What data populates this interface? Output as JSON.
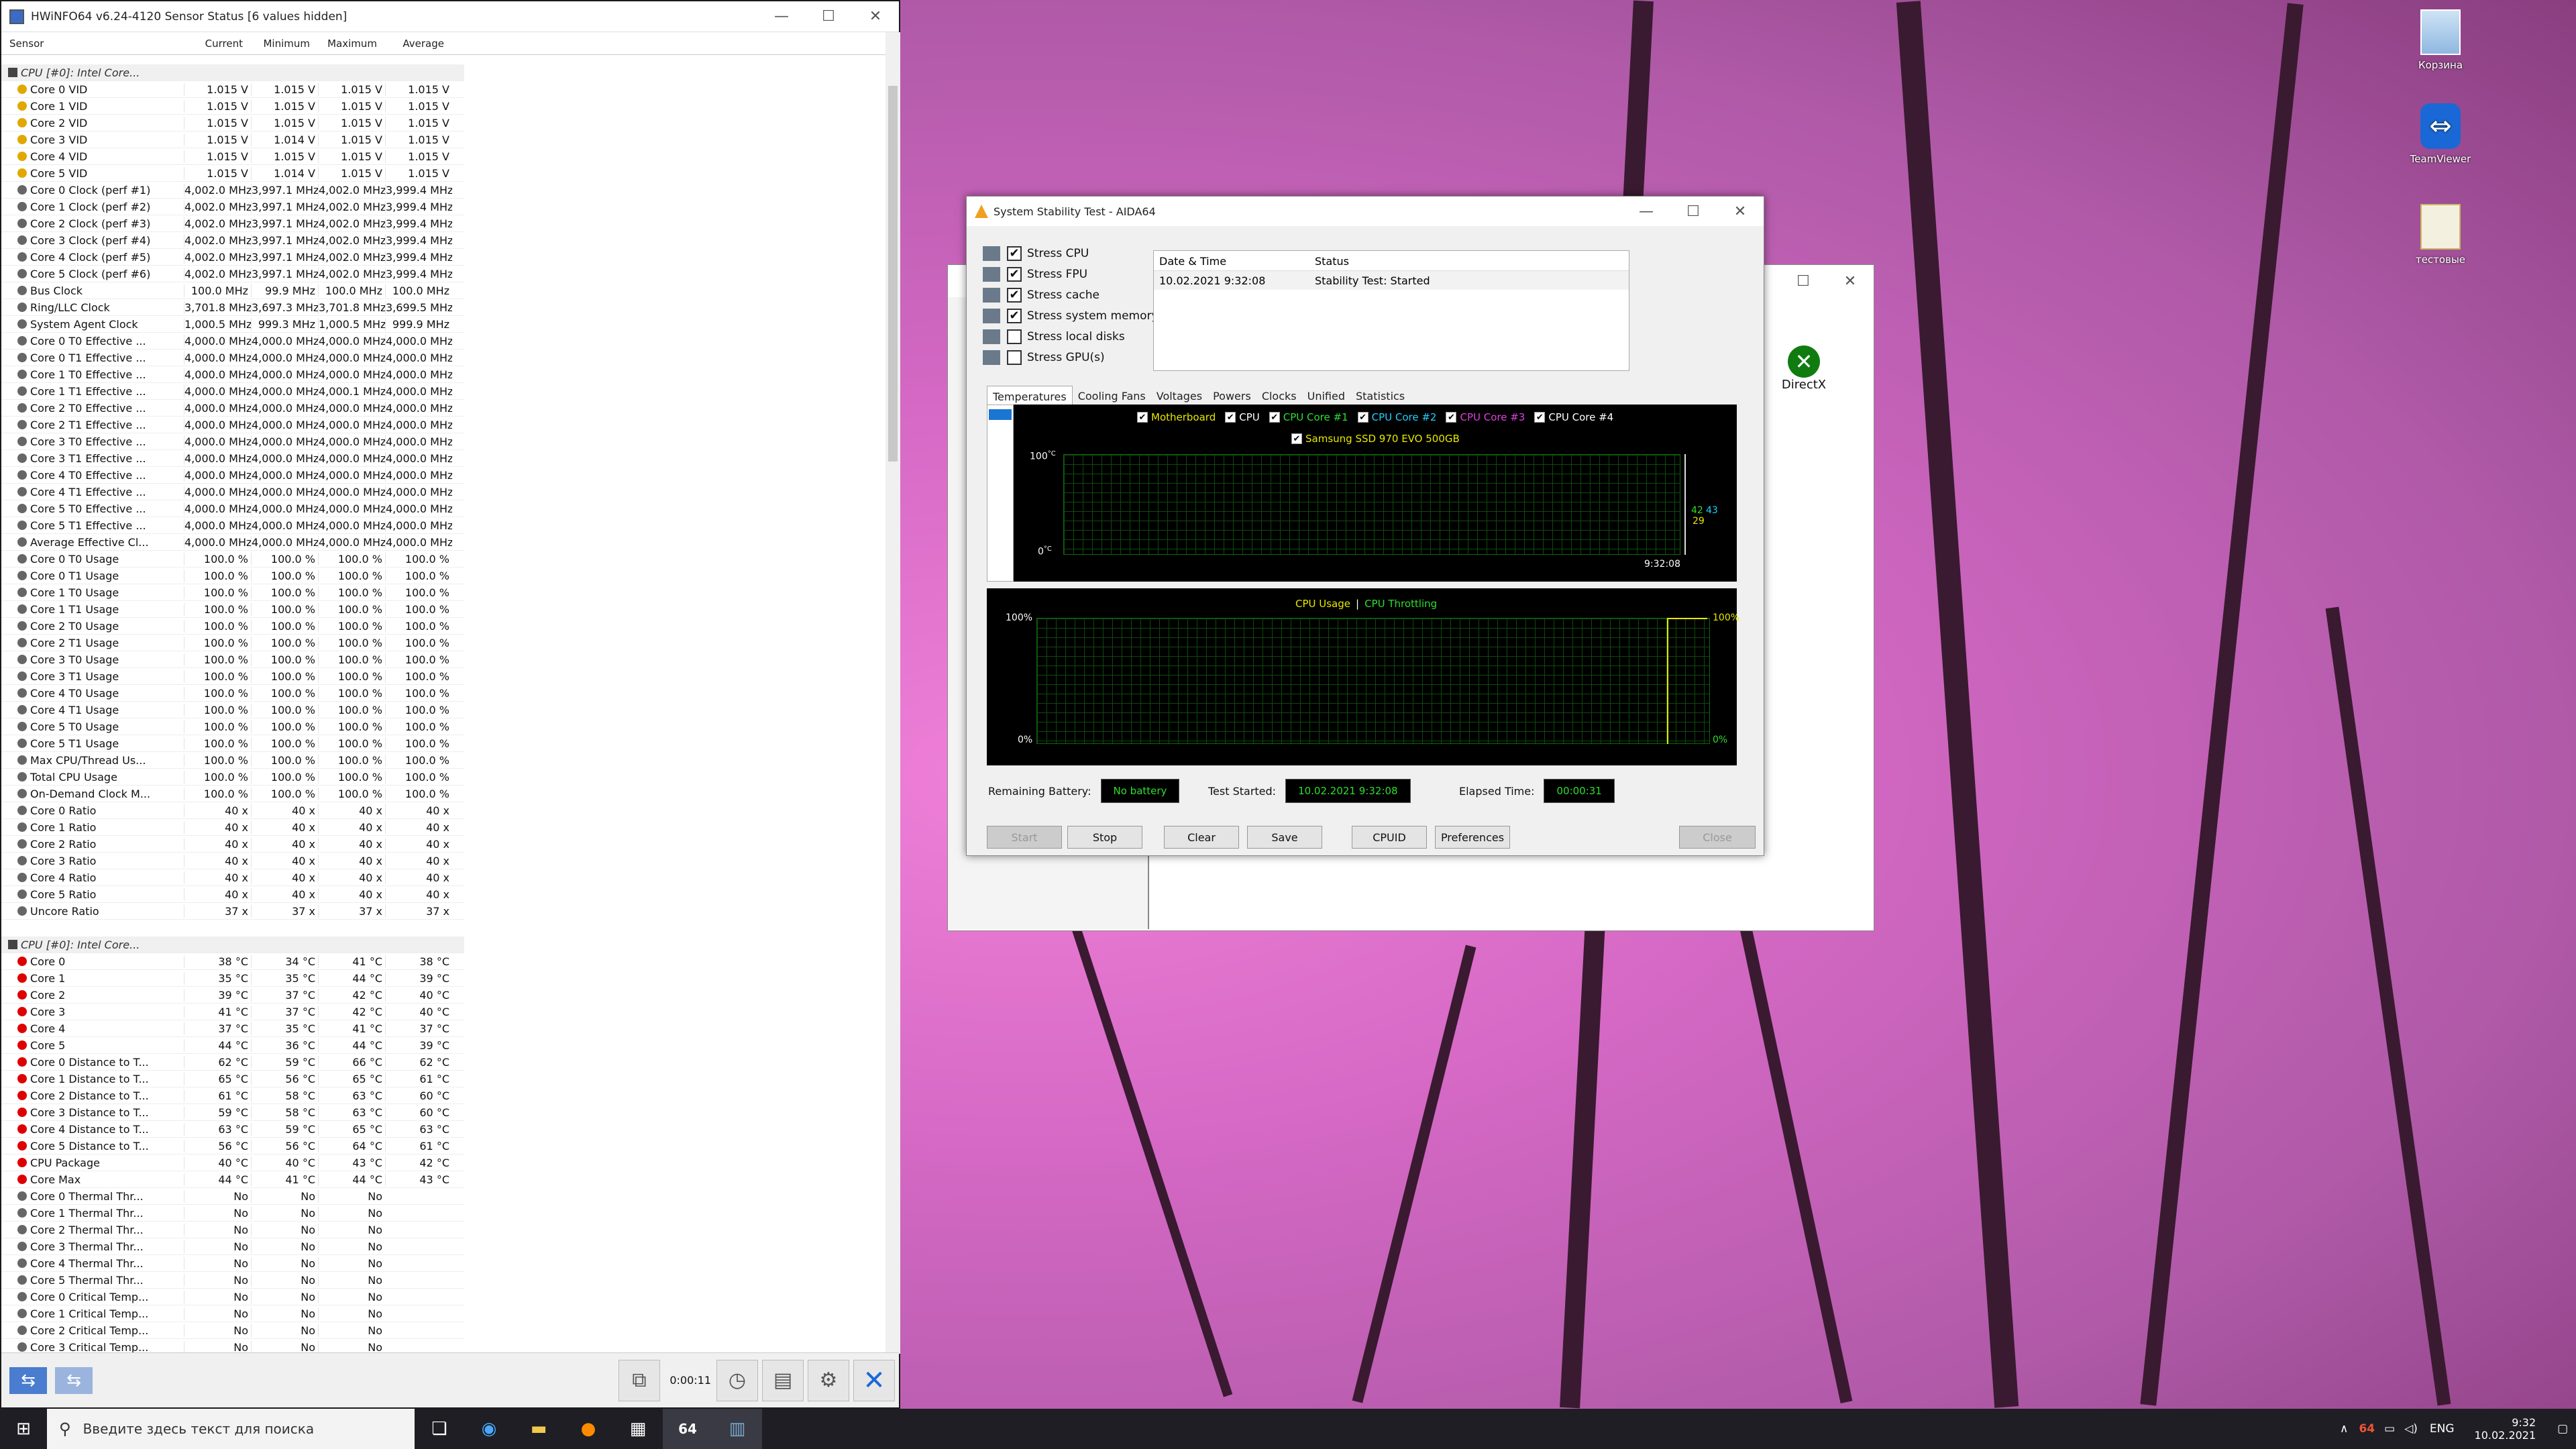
{
  "hwinfo": {
    "title": "HWiNFO64 v6.24-4120 Sensor Status [6 values hidden]",
    "columns": [
      "Sensor",
      "Current",
      "Minimum",
      "Maximum",
      "Average"
    ],
    "rows": [
      {
        "n": "CPU [#0]: Intel Core...",
        "v": [
          "",
          "",
          "",
          ""
        ],
        "g": true,
        "i": "#444"
      },
      {
        "n": "Core 0 VID",
        "v": [
          "1.015 V",
          "1.015 V",
          "1.015 V",
          "1.015 V"
        ],
        "i": "#e0a800"
      },
      {
        "n": "Core 1 VID",
        "v": [
          "1.015 V",
          "1.015 V",
          "1.015 V",
          "1.015 V"
        ],
        "i": "#e0a800"
      },
      {
        "n": "Core 2 VID",
        "v": [
          "1.015 V",
          "1.015 V",
          "1.015 V",
          "1.015 V"
        ],
        "i": "#e0a800"
      },
      {
        "n": "Core 3 VID",
        "v": [
          "1.015 V",
          "1.014 V",
          "1.015 V",
          "1.015 V"
        ],
        "i": "#e0a800"
      },
      {
        "n": "Core 4 VID",
        "v": [
          "1.015 V",
          "1.015 V",
          "1.015 V",
          "1.015 V"
        ],
        "i": "#e0a800"
      },
      {
        "n": "Core 5 VID",
        "v": [
          "1.015 V",
          "1.014 V",
          "1.015 V",
          "1.015 V"
        ],
        "i": "#e0a800"
      },
      {
        "n": "Core 0 Clock (perf #1)",
        "v": [
          "4,002.0 MHz",
          "3,997.1 MHz",
          "4,002.0 MHz",
          "3,999.4 MHz"
        ],
        "i": "#666"
      },
      {
        "n": "Core 1 Clock (perf #2)",
        "v": [
          "4,002.0 MHz",
          "3,997.1 MHz",
          "4,002.0 MHz",
          "3,999.4 MHz"
        ],
        "i": "#666"
      },
      {
        "n": "Core 2 Clock (perf #3)",
        "v": [
          "4,002.0 MHz",
          "3,997.1 MHz",
          "4,002.0 MHz",
          "3,999.4 MHz"
        ],
        "i": "#666"
      },
      {
        "n": "Core 3 Clock (perf #4)",
        "v": [
          "4,002.0 MHz",
          "3,997.1 MHz",
          "4,002.0 MHz",
          "3,999.4 MHz"
        ],
        "i": "#666"
      },
      {
        "n": "Core 4 Clock (perf #5)",
        "v": [
          "4,002.0 MHz",
          "3,997.1 MHz",
          "4,002.0 MHz",
          "3,999.4 MHz"
        ],
        "i": "#666"
      },
      {
        "n": "Core 5 Clock (perf #6)",
        "v": [
          "4,002.0 MHz",
          "3,997.1 MHz",
          "4,002.0 MHz",
          "3,999.4 MHz"
        ],
        "i": "#666"
      },
      {
        "n": "Bus Clock",
        "v": [
          "100.0 MHz",
          "99.9 MHz",
          "100.0 MHz",
          "100.0 MHz"
        ],
        "i": "#666"
      },
      {
        "n": "Ring/LLC Clock",
        "v": [
          "3,701.8 MHz",
          "3,697.3 MHz",
          "3,701.8 MHz",
          "3,699.5 MHz"
        ],
        "i": "#666"
      },
      {
        "n": "System Agent Clock",
        "v": [
          "1,000.5 MHz",
          "999.3 MHz",
          "1,000.5 MHz",
          "999.9 MHz"
        ],
        "i": "#666"
      },
      {
        "n": "Core 0 T0 Effective ...",
        "v": [
          "4,000.0 MHz",
          "4,000.0 MHz",
          "4,000.0 MHz",
          "4,000.0 MHz"
        ],
        "i": "#666"
      },
      {
        "n": "Core 0 T1 Effective ...",
        "v": [
          "4,000.0 MHz",
          "4,000.0 MHz",
          "4,000.0 MHz",
          "4,000.0 MHz"
        ],
        "i": "#666"
      },
      {
        "n": "Core 1 T0 Effective ...",
        "v": [
          "4,000.0 MHz",
          "4,000.0 MHz",
          "4,000.0 MHz",
          "4,000.0 MHz"
        ],
        "i": "#666"
      },
      {
        "n": "Core 1 T1 Effective ...",
        "v": [
          "4,000.0 MHz",
          "4,000.0 MHz",
          "4,000.1 MHz",
          "4,000.0 MHz"
        ],
        "i": "#666"
      },
      {
        "n": "Core 2 T0 Effective ...",
        "v": [
          "4,000.0 MHz",
          "4,000.0 MHz",
          "4,000.0 MHz",
          "4,000.0 MHz"
        ],
        "i": "#666"
      },
      {
        "n": "Core 2 T1 Effective ...",
        "v": [
          "4,000.0 MHz",
          "4,000.0 MHz",
          "4,000.0 MHz",
          "4,000.0 MHz"
        ],
        "i": "#666"
      },
      {
        "n": "Core 3 T0 Effective ...",
        "v": [
          "4,000.0 MHz",
          "4,000.0 MHz",
          "4,000.0 MHz",
          "4,000.0 MHz"
        ],
        "i": "#666"
      },
      {
        "n": "Core 3 T1 Effective ...",
        "v": [
          "4,000.0 MHz",
          "4,000.0 MHz",
          "4,000.0 MHz",
          "4,000.0 MHz"
        ],
        "i": "#666"
      },
      {
        "n": "Core 4 T0 Effective ...",
        "v": [
          "4,000.0 MHz",
          "4,000.0 MHz",
          "4,000.0 MHz",
          "4,000.0 MHz"
        ],
        "i": "#666"
      },
      {
        "n": "Core 4 T1 Effective ...",
        "v": [
          "4,000.0 MHz",
          "4,000.0 MHz",
          "4,000.0 MHz",
          "4,000.0 MHz"
        ],
        "i": "#666"
      },
      {
        "n": "Core 5 T0 Effective ...",
        "v": [
          "4,000.0 MHz",
          "4,000.0 MHz",
          "4,000.0 MHz",
          "4,000.0 MHz"
        ],
        "i": "#666"
      },
      {
        "n": "Core 5 T1 Effective ...",
        "v": [
          "4,000.0 MHz",
          "4,000.0 MHz",
          "4,000.0 MHz",
          "4,000.0 MHz"
        ],
        "i": "#666"
      },
      {
        "n": "Average Effective Cl...",
        "v": [
          "4,000.0 MHz",
          "4,000.0 MHz",
          "4,000.0 MHz",
          "4,000.0 MHz"
        ],
        "i": "#666"
      },
      {
        "n": "Core 0 T0 Usage",
        "v": [
          "100.0 %",
          "100.0 %",
          "100.0 %",
          "100.0 %"
        ],
        "i": "#666"
      },
      {
        "n": "Core 0 T1 Usage",
        "v": [
          "100.0 %",
          "100.0 %",
          "100.0 %",
          "100.0 %"
        ],
        "i": "#666"
      },
      {
        "n": "Core 1 T0 Usage",
        "v": [
          "100.0 %",
          "100.0 %",
          "100.0 %",
          "100.0 %"
        ],
        "i": "#666"
      },
      {
        "n": "Core 1 T1 Usage",
        "v": [
          "100.0 %",
          "100.0 %",
          "100.0 %",
          "100.0 %"
        ],
        "i": "#666"
      },
      {
        "n": "Core 2 T0 Usage",
        "v": [
          "100.0 %",
          "100.0 %",
          "100.0 %",
          "100.0 %"
        ],
        "i": "#666"
      },
      {
        "n": "Core 2 T1 Usage",
        "v": [
          "100.0 %",
          "100.0 %",
          "100.0 %",
          "100.0 %"
        ],
        "i": "#666"
      },
      {
        "n": "Core 3 T0 Usage",
        "v": [
          "100.0 %",
          "100.0 %",
          "100.0 %",
          "100.0 %"
        ],
        "i": "#666"
      },
      {
        "n": "Core 3 T1 Usage",
        "v": [
          "100.0 %",
          "100.0 %",
          "100.0 %",
          "100.0 %"
        ],
        "i": "#666"
      },
      {
        "n": "Core 4 T0 Usage",
        "v": [
          "100.0 %",
          "100.0 %",
          "100.0 %",
          "100.0 %"
        ],
        "i": "#666"
      },
      {
        "n": "Core 4 T1 Usage",
        "v": [
          "100.0 %",
          "100.0 %",
          "100.0 %",
          "100.0 %"
        ],
        "i": "#666"
      },
      {
        "n": "Core 5 T0 Usage",
        "v": [
          "100.0 %",
          "100.0 %",
          "100.0 %",
          "100.0 %"
        ],
        "i": "#666"
      },
      {
        "n": "Core 5 T1 Usage",
        "v": [
          "100.0 %",
          "100.0 %",
          "100.0 %",
          "100.0 %"
        ],
        "i": "#666"
      },
      {
        "n": "Max CPU/Thread Us...",
        "v": [
          "100.0 %",
          "100.0 %",
          "100.0 %",
          "100.0 %"
        ],
        "i": "#666"
      },
      {
        "n": "Total CPU Usage",
        "v": [
          "100.0 %",
          "100.0 %",
          "100.0 %",
          "100.0 %"
        ],
        "i": "#666"
      },
      {
        "n": "On-Demand Clock M...",
        "v": [
          "100.0 %",
          "100.0 %",
          "100.0 %",
          "100.0 %"
        ],
        "i": "#666"
      },
      {
        "n": "Core 0 Ratio",
        "v": [
          "40 x",
          "40 x",
          "40 x",
          "40 x"
        ],
        "i": "#666"
      },
      {
        "n": "Core 1 Ratio",
        "v": [
          "40 x",
          "40 x",
          "40 x",
          "40 x"
        ],
        "i": "#666"
      },
      {
        "n": "Core 2 Ratio",
        "v": [
          "40 x",
          "40 x",
          "40 x",
          "40 x"
        ],
        "i": "#666"
      },
      {
        "n": "Core 3 Ratio",
        "v": [
          "40 x",
          "40 x",
          "40 x",
          "40 x"
        ],
        "i": "#666"
      },
      {
        "n": "Core 4 Ratio",
        "v": [
          "40 x",
          "40 x",
          "40 x",
          "40 x"
        ],
        "i": "#666"
      },
      {
        "n": "Core 5 Ratio",
        "v": [
          "40 x",
          "40 x",
          "40 x",
          "40 x"
        ],
        "i": "#666"
      },
      {
        "n": "Uncore Ratio",
        "v": [
          "37 x",
          "37 x",
          "37 x",
          "37 x"
        ],
        "i": "#666"
      },
      {
        "n": "",
        "v": [
          "",
          "",
          "",
          ""
        ],
        "b": true
      },
      {
        "n": "CPU [#0]: Intel Core...",
        "v": [
          "",
          "",
          "",
          ""
        ],
        "g": true,
        "i": "#444"
      },
      {
        "n": "Core 0",
        "v": [
          "38 °C",
          "34 °C",
          "41 °C",
          "38 °C"
        ],
        "i": "#d00"
      },
      {
        "n": "Core 1",
        "v": [
          "35 °C",
          "35 °C",
          "44 °C",
          "39 °C"
        ],
        "i": "#d00"
      },
      {
        "n": "Core 2",
        "v": [
          "39 °C",
          "37 °C",
          "42 °C",
          "40 °C"
        ],
        "i": "#d00"
      },
      {
        "n": "Core 3",
        "v": [
          "41 °C",
          "37 °C",
          "42 °C",
          "40 °C"
        ],
        "i": "#d00"
      },
      {
        "n": "Core 4",
        "v": [
          "37 °C",
          "35 °C",
          "41 °C",
          "37 °C"
        ],
        "i": "#d00"
      },
      {
        "n": "Core 5",
        "v": [
          "44 °C",
          "36 °C",
          "44 °C",
          "39 °C"
        ],
        "i": "#d00"
      },
      {
        "n": "Core 0 Distance to T...",
        "v": [
          "62 °C",
          "59 °C",
          "66 °C",
          "62 °C"
        ],
        "i": "#d00"
      },
      {
        "n": "Core 1 Distance to T...",
        "v": [
          "65 °C",
          "56 °C",
          "65 °C",
          "61 °C"
        ],
        "i": "#d00"
      },
      {
        "n": "Core 2 Distance to T...",
        "v": [
          "61 °C",
          "58 °C",
          "63 °C",
          "60 °C"
        ],
        "i": "#d00"
      },
      {
        "n": "Core 3 Distance to T...",
        "v": [
          "59 °C",
          "58 °C",
          "63 °C",
          "60 °C"
        ],
        "i": "#d00"
      },
      {
        "n": "Core 4 Distance to T...",
        "v": [
          "63 °C",
          "59 °C",
          "65 °C",
          "63 °C"
        ],
        "i": "#d00"
      },
      {
        "n": "Core 5 Distance to T...",
        "v": [
          "56 °C",
          "56 °C",
          "64 °C",
          "61 °C"
        ],
        "i": "#d00"
      },
      {
        "n": "CPU Package",
        "v": [
          "40 °C",
          "40 °C",
          "43 °C",
          "42 °C"
        ],
        "i": "#d00"
      },
      {
        "n": "Core Max",
        "v": [
          "44 °C",
          "41 °C",
          "44 °C",
          "43 °C"
        ],
        "i": "#d00"
      },
      {
        "n": "Core 0 Thermal Thr...",
        "v": [
          "No",
          "No",
          "No",
          ""
        ],
        "i": "#666"
      },
      {
        "n": "Core 1 Thermal Thr...",
        "v": [
          "No",
          "No",
          "No",
          ""
        ],
        "i": "#666"
      },
      {
        "n": "Core 2 Thermal Thr...",
        "v": [
          "No",
          "No",
          "No",
          ""
        ],
        "i": "#666"
      },
      {
        "n": "Core 3 Thermal Thr...",
        "v": [
          "No",
          "No",
          "No",
          ""
        ],
        "i": "#666"
      },
      {
        "n": "Core 4 Thermal Thr...",
        "v": [
          "No",
          "No",
          "No",
          ""
        ],
        "i": "#666"
      },
      {
        "n": "Core 5 Thermal Thr...",
        "v": [
          "No",
          "No",
          "No",
          ""
        ],
        "i": "#666"
      },
      {
        "n": "Core 0 Critical Temp...",
        "v": [
          "No",
          "No",
          "No",
          ""
        ],
        "i": "#666"
      },
      {
        "n": "Core 1 Critical Temp...",
        "v": [
          "No",
          "No",
          "No",
          ""
        ],
        "i": "#666"
      },
      {
        "n": "Core 2 Critical Temp...",
        "v": [
          "No",
          "No",
          "No",
          ""
        ],
        "i": "#666"
      },
      {
        "n": "Core 3 Critical Temp...",
        "v": [
          "No",
          "No",
          "No",
          ""
        ],
        "i": "#666"
      }
    ],
    "timer": "0:00:11"
  },
  "aida": {
    "title": "System Stability Test - AIDA64",
    "stress": [
      {
        "label": "Stress CPU",
        "checked": true
      },
      {
        "label": "Stress FPU",
        "checked": true
      },
      {
        "label": "Stress cache",
        "checked": true
      },
      {
        "label": "Stress system memory",
        "checked": true
      },
      {
        "label": "Stress local disks",
        "checked": false
      },
      {
        "label": "Stress GPU(s)",
        "checked": false
      }
    ],
    "log_headers": [
      "Date & Time",
      "Status"
    ],
    "log_rows": [
      [
        "10.02.2021 9:32:08",
        "Stability Test: Started"
      ]
    ],
    "tabs": [
      "Temperatures",
      "Cooling Fans",
      "Voltages",
      "Powers",
      "Clocks",
      "Unified",
      "Statistics"
    ],
    "temp_legend": [
      {
        "label": "Motherboard",
        "color": "#e8e800"
      },
      {
        "label": "CPU",
        "color": "#ffffff"
      },
      {
        "label": "CPU Core #1",
        "color": "#2ede2e"
      },
      {
        "label": "CPU Core #2",
        "color": "#20d0ff"
      },
      {
        "label": "CPU Core #3",
        "color": "#e040e0"
      },
      {
        "label": "CPU Core #4",
        "color": "#ffffff"
      }
    ],
    "temp_legend2": {
      "label": "Samsung SSD 970 EVO 500GB",
      "color": "#e8e800"
    },
    "temp_axis": {
      "top": "100",
      "bottom": "0",
      "unit": "°C",
      "time": "9:32:08",
      "right_a": "42",
      "right_b": "43",
      "right_c": "29"
    },
    "cpu_legend": [
      {
        "label": "CPU Usage",
        "color": "#e8e800"
      },
      {
        "label": "CPU Throttling",
        "color": "#2ede2e"
      }
    ],
    "cpu_legend_sep": "|",
    "cpu_axis": {
      "top": "100%",
      "bottom": "0%",
      "right_top": "100%",
      "right_bottom": "0%"
    },
    "battery_label": "Remaining Battery:",
    "battery_value": "No battery",
    "started_label": "Test Started:",
    "started_value": "10.02.2021 9:32:08",
    "elapsed_label": "Elapsed Time:",
    "elapsed_value": "00:00:31",
    "buttons": {
      "start": "Start",
      "stop": "Stop",
      "clear": "Clear",
      "save": "Save",
      "cpuid": "CPUID",
      "prefs": "Preferences",
      "close": "Close"
    }
  },
  "bg_window": {
    "directx": "DirectX"
  },
  "desktop_icons": [
    {
      "label": "Корзина",
      "icon": "recycle-bin-icon"
    },
    {
      "label": "TeamViewer",
      "icon": "teamviewer-icon"
    },
    {
      "label": "тестовые",
      "icon": "folder-icon"
    }
  ],
  "taskbar": {
    "search_placeholder": "Введите здесь текст для поиска",
    "lang": "ENG",
    "time": "9:32",
    "date": "10.02.2021",
    "badge": "64"
  }
}
